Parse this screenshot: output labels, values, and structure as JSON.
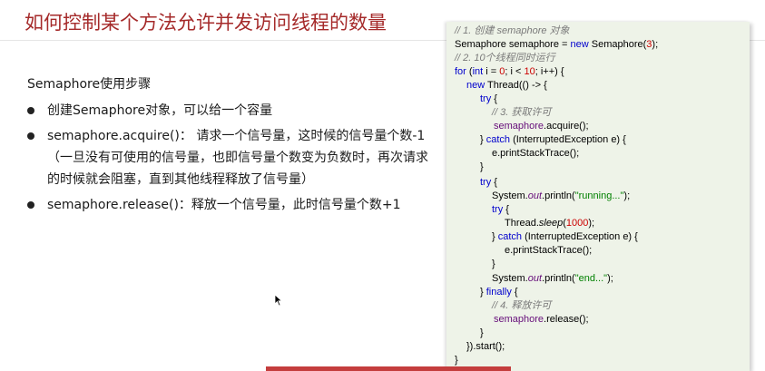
{
  "slide": {
    "title": "如何控制某个方法允许并发访问线程的数量",
    "section_heading": "Semaphore使用步骤",
    "bullets": [
      {
        "text": "创建Semaphore对象，可以给一个容量"
      },
      {
        "text": "semaphore.acquire()： 请求一个信号量，这时候的信号量个数-1（一旦没有可使用的信号量，也即信号量个数变为负数时，再次请求的时候就会阻塞，直到其他线程释放了信号量）"
      },
      {
        "text": "semaphore.release()：释放一个信号量，此时信号量个数+1"
      }
    ]
  },
  "code": {
    "l1": "// 1. 创建 semaphore 对象",
    "l2a": "Semaphore semaphore = ",
    "l2b": "new",
    "l2c": " Semaphore(",
    "l2d": "3",
    "l2e": ");",
    "l3": "// 2. 10个线程同时运行",
    "l4a": "for",
    "l4b": " (",
    "l4c": "int",
    "l4d": " i = ",
    "l4e": "0",
    "l4f": "; i < ",
    "l4g": "10",
    "l4h": "; i++) {",
    "l5a": "new",
    "l5b": " Thread(() -> {",
    "l6": "try",
    "l6b": " {",
    "l7": "// 3. 获取许可",
    "l8a": "semaphore",
    "l8b": ".acquire();",
    "l9a": "} ",
    "l9b": "catch",
    "l9c": " (InterruptedException e) {",
    "l10": "e.printStackTrace();",
    "l11": "}",
    "l12a": "try",
    "l12b": " {",
    "l13a": "System.",
    "l13b": "out",
    "l13c": ".println(",
    "l13d": "\"running...\"",
    "l13e": ");",
    "l14a": "try",
    "l14b": " {",
    "l15a": "Thread.",
    "l15b": "sleep",
    "l15c": "(",
    "l15d": "1000",
    "l15e": ");",
    "l16a": "} ",
    "l16b": "catch",
    "l16c": " (InterruptedException e) {",
    "l17": "e.printStackTrace();",
    "l18": "}",
    "l19a": "System.",
    "l19b": "out",
    "l19c": ".println(",
    "l19d": "\"end...\"",
    "l19e": ");",
    "l20a": "} ",
    "l20b": "finally",
    "l20c": " {",
    "l21": "// 4. 释放许可",
    "l22a": "semaphore",
    "l22b": ".release();",
    "l23": "}",
    "l24": "}).start();",
    "l25": "}"
  },
  "colors": {
    "title": "#a52a2a",
    "keyword": "#0000cc",
    "comment": "#7a7a7a",
    "number": "#cc0000",
    "string": "#008000",
    "field": "#660e7a",
    "panel_bg": "#eef3e8",
    "accent_bar": "#c43d3d"
  },
  "icons": {
    "cursor": "mouse-pointer-icon"
  }
}
